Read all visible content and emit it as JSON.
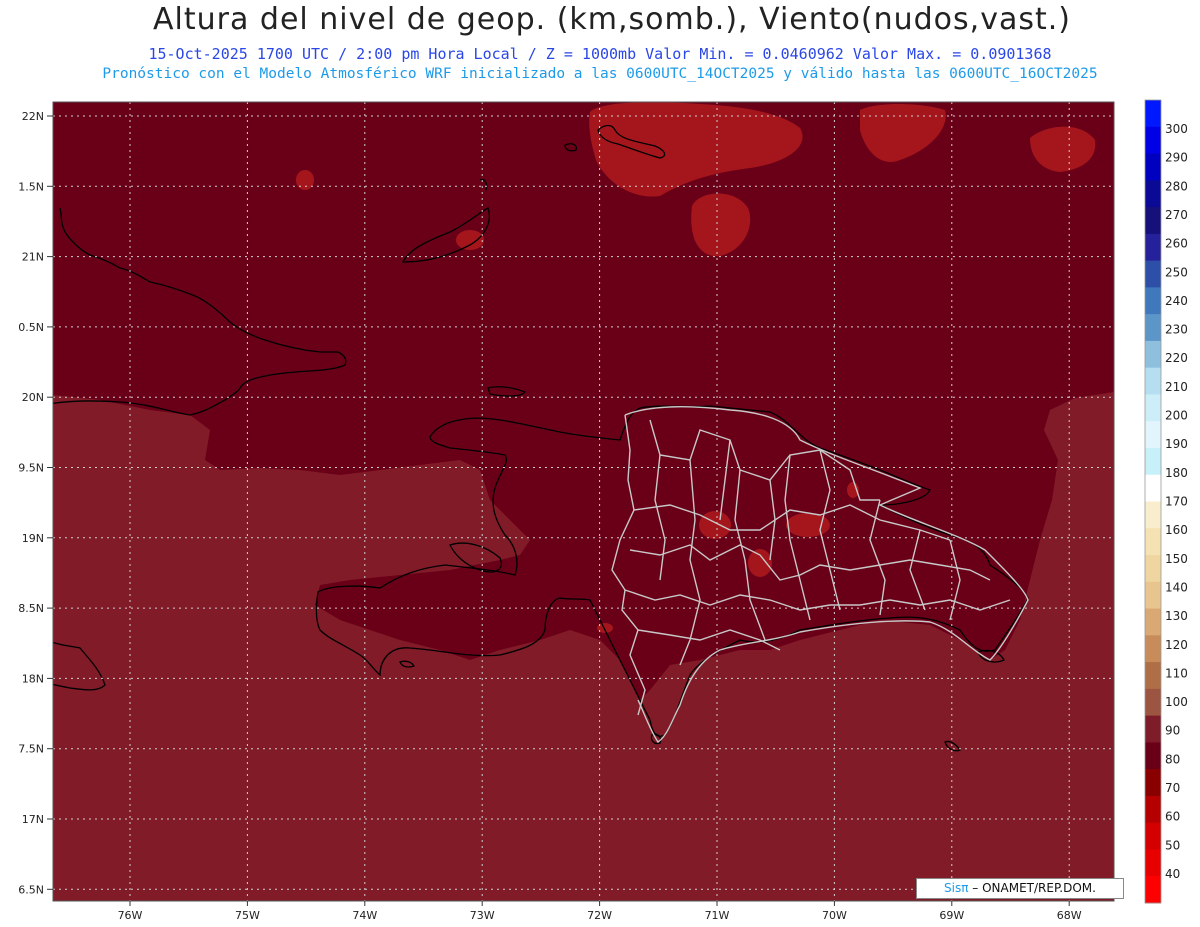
{
  "header": {
    "title": "Altura del nivel de geop. (km,somb.), Viento(nudos,vast.)",
    "subtitle_1": "15-Oct-2025  1700 UTC / 2:00 pm Hora Local / Z = 1000mb Valor Min. = 0.0460962  Valor Max. = 0.0901368",
    "subtitle_2": "Pronóstico con el Modelo Atmosférico WRF inicializado a las 0600UTC_14OCT2025 y válido hasta las  0600UTC_16OCT2025"
  },
  "map": {
    "lat_labels": [
      "22N",
      "1.5N",
      "21N",
      "0.5N",
      "20N",
      "9.5N",
      "19N",
      "8.5N",
      "18N",
      "7.5N",
      "17N",
      "6.5N"
    ],
    "lon_labels": [
      "76W",
      "75W",
      "74W",
      "73W",
      "72W",
      "71W",
      "70W",
      "69W",
      "68W"
    ],
    "colors": {
      "background_field": "#811b28",
      "dark_field": "#6a0018",
      "highlight_field": "#a5161c",
      "coastline": "#000000",
      "province_border": "#c8c8c8",
      "grid": "#d0d0d0"
    }
  },
  "colorbar": {
    "labels": [
      "300",
      "290",
      "280",
      "270",
      "260",
      "250",
      "240",
      "230",
      "220",
      "210",
      "200",
      "190",
      "180",
      "170",
      "160",
      "150",
      "140",
      "130",
      "120",
      "110",
      "100",
      "90",
      "80",
      "70",
      "60",
      "50",
      "40"
    ],
    "colors": [
      "#0018ff",
      "#0000e6",
      "#0000c0",
      "#0a0a96",
      "#16107a",
      "#25219a",
      "#2e4fa8",
      "#3f78bb",
      "#5c96c8",
      "#8ec0de",
      "#b5dff0",
      "#cdeef8",
      "#e2f5fc",
      "#c7f0f8",
      "#ffffff",
      "#f8edcc",
      "#f4e2b2",
      "#efd6a0",
      "#e8c58e",
      "#d9a873",
      "#c78c5a",
      "#b06e46",
      "#9c5540",
      "#7e1c2a",
      "#6a0018",
      "#8a0000",
      "#b40000",
      "#d40000",
      "#e80000",
      "#ff0000"
    ]
  },
  "credit": {
    "brand": "Sisπ",
    "text": " – ONAMET/REP.DOM."
  }
}
